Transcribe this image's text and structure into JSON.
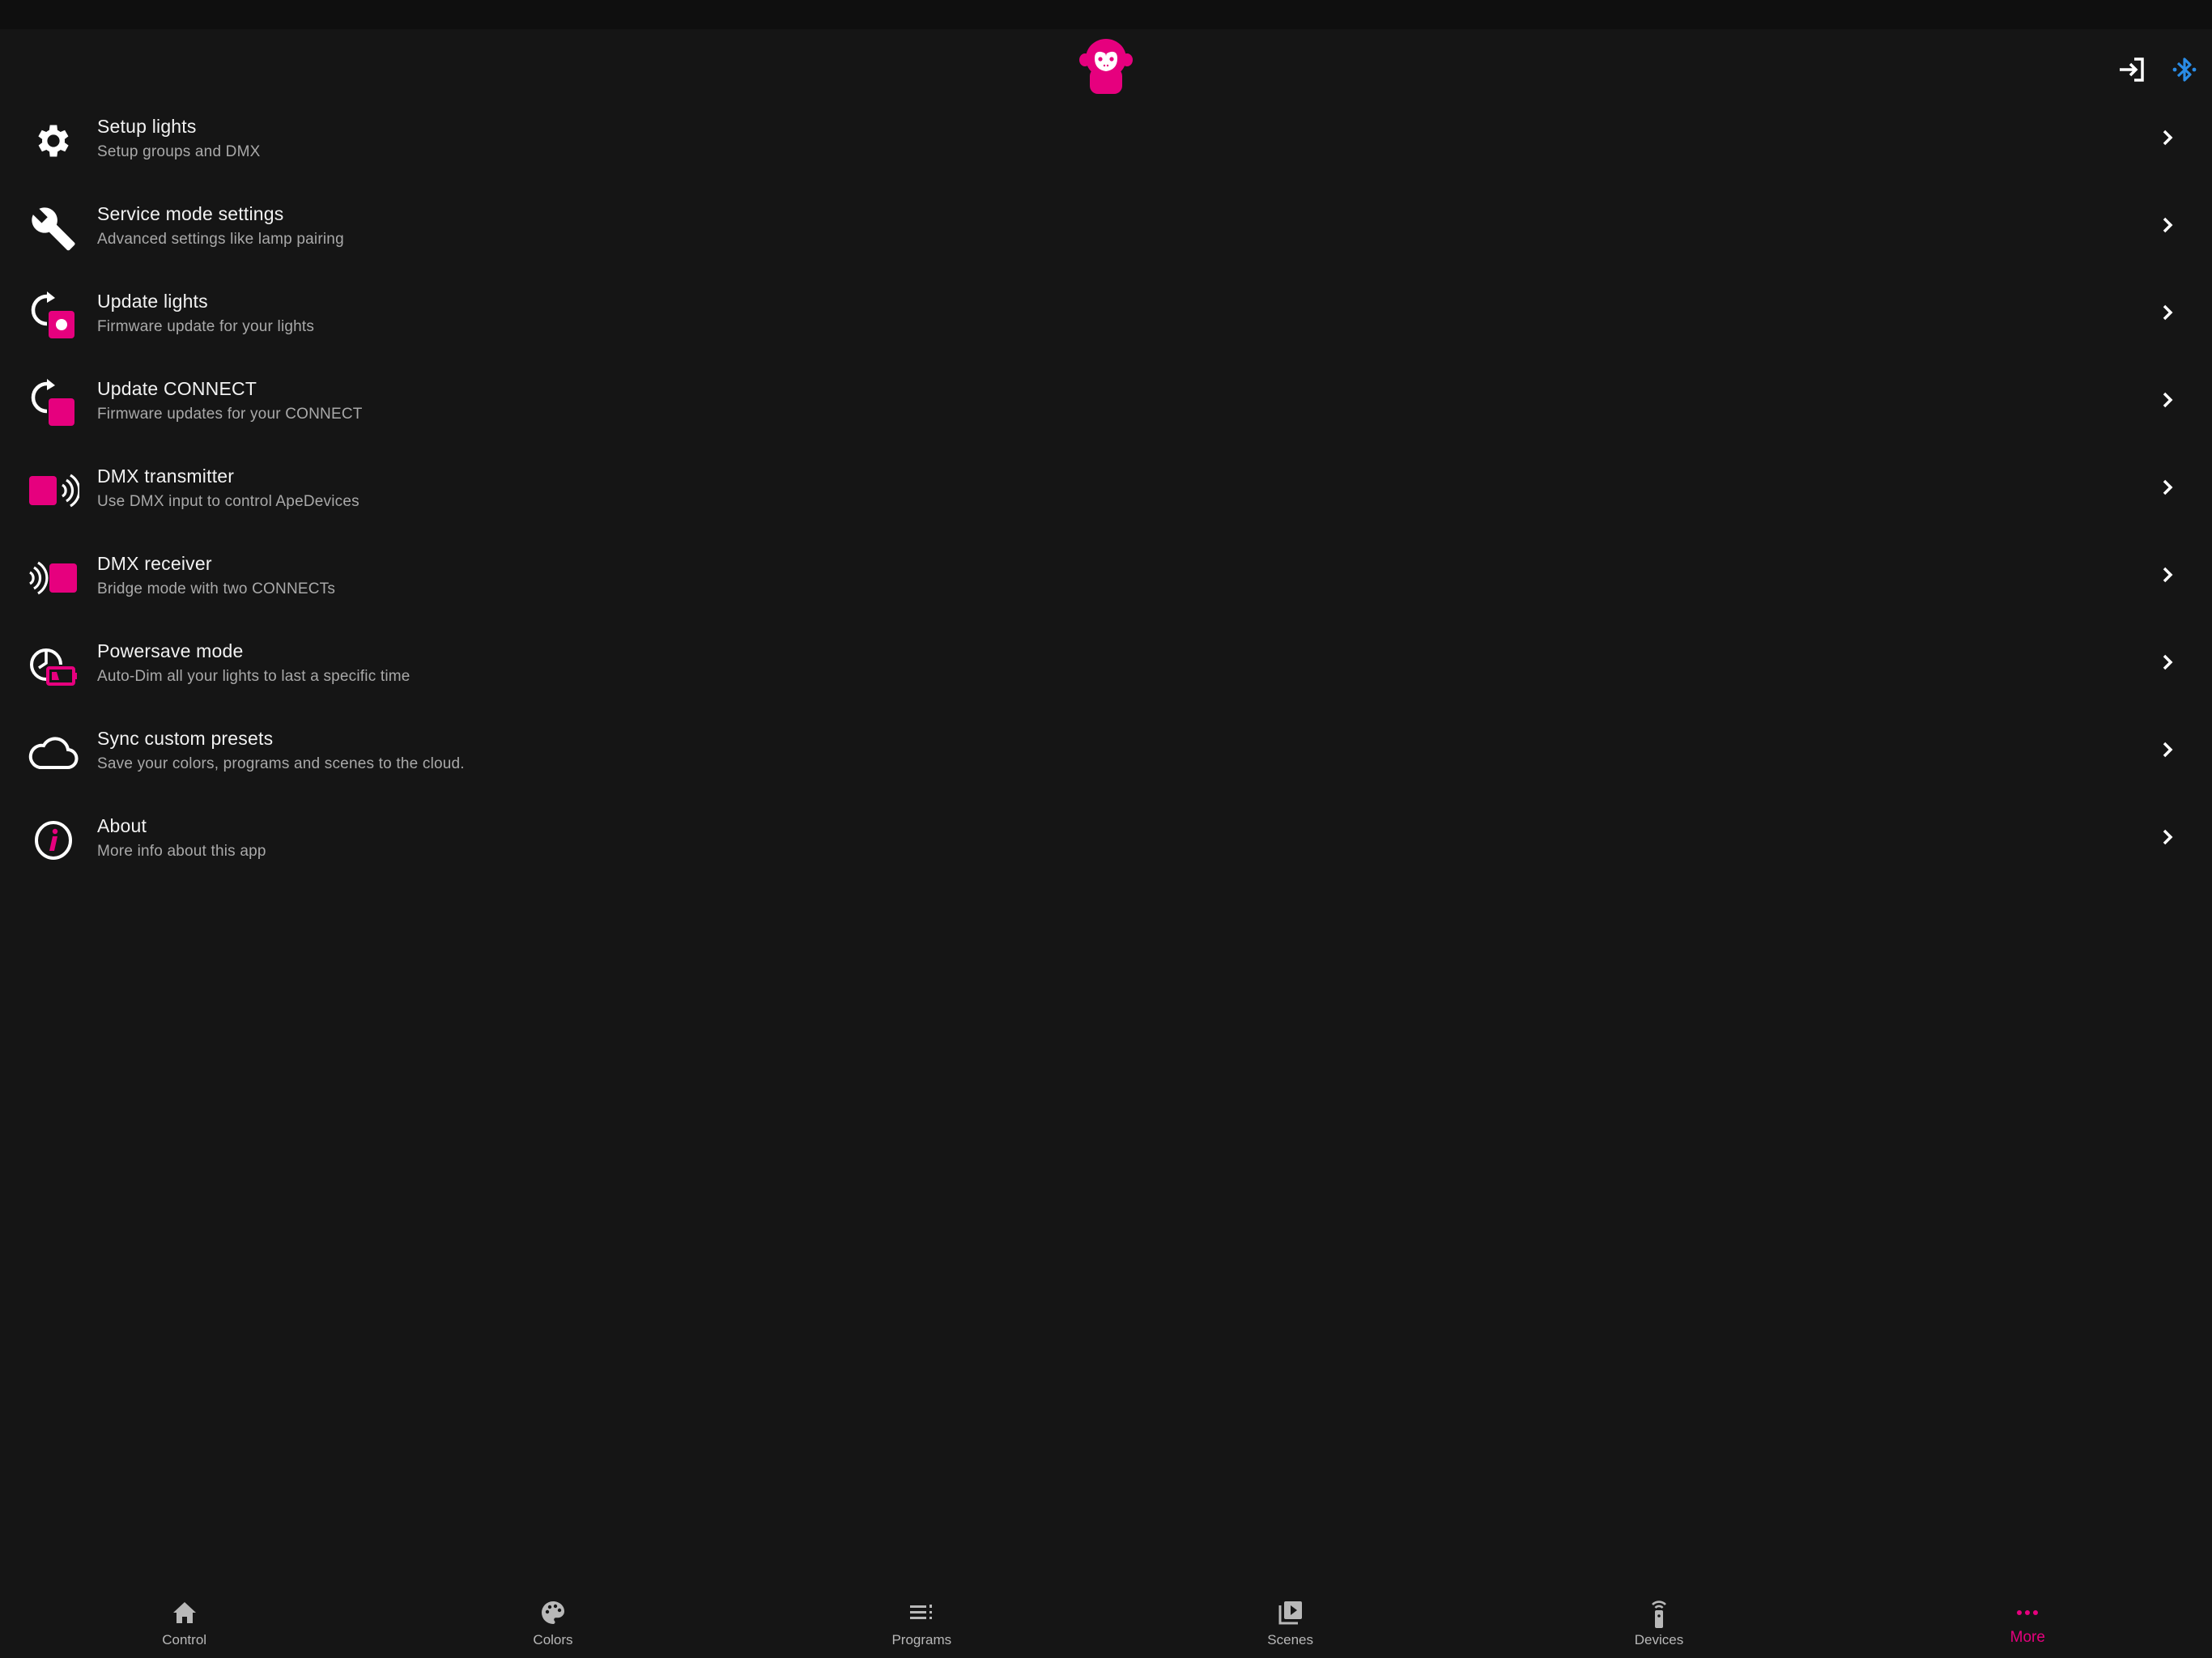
{
  "colors": {
    "accent": "#e6007e",
    "bluetooth": "#2a8ce6",
    "background": "#151515",
    "text": "#f2f2f2",
    "subtext": "#a9a9a9"
  },
  "header": {
    "logo": "monkey-logo-icon",
    "actions": [
      {
        "icon": "login-icon",
        "label": "Login"
      },
      {
        "icon": "bluetooth-icon",
        "label": "Bluetooth"
      }
    ]
  },
  "menu": {
    "items": [
      {
        "icon": "gear-icon",
        "title": "Setup lights",
        "subtitle": "Setup groups and DMX"
      },
      {
        "icon": "wrench-icon",
        "title": "Service mode settings",
        "subtitle": "Advanced settings like lamp pairing"
      },
      {
        "icon": "update-lights-icon",
        "title": "Update lights",
        "subtitle": "Firmware update for your lights"
      },
      {
        "icon": "update-connect-icon",
        "title": "Update CONNECT",
        "subtitle": "Firmware updates for your CONNECT"
      },
      {
        "icon": "dmx-transmitter-icon",
        "title": "DMX transmitter",
        "subtitle": "Use DMX input to control ApeDevices"
      },
      {
        "icon": "dmx-receiver-icon",
        "title": "DMX receiver",
        "subtitle": "Bridge mode with two CONNECTs"
      },
      {
        "icon": "powersave-icon",
        "title": "Powersave mode",
        "subtitle": "Auto-Dim all your lights to last a specific time"
      },
      {
        "icon": "cloud-icon",
        "title": "Sync custom presets",
        "subtitle": "Save your colors, programs and scenes to the cloud."
      },
      {
        "icon": "info-icon",
        "title": "About",
        "subtitle": "More info about this app"
      }
    ]
  },
  "bottom_nav": {
    "active": "More",
    "items": [
      {
        "icon": "home-icon",
        "label": "Control"
      },
      {
        "icon": "palette-icon",
        "label": "Colors"
      },
      {
        "icon": "list-icon",
        "label": "Programs"
      },
      {
        "icon": "scenes-icon",
        "label": "Scenes"
      },
      {
        "icon": "remote-icon",
        "label": "Devices"
      },
      {
        "icon": "more-icon",
        "label": "More"
      }
    ]
  }
}
